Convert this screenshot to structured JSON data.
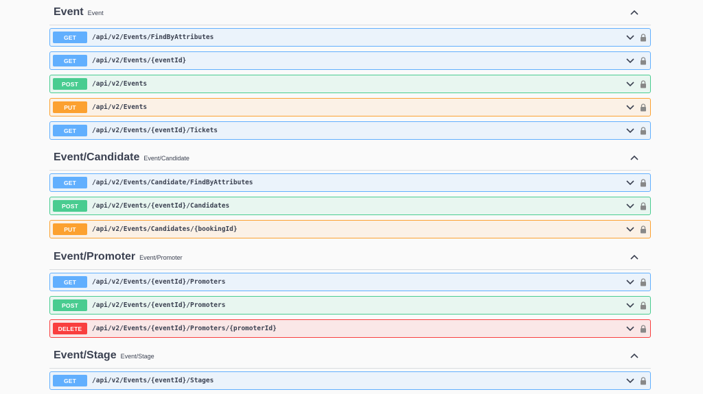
{
  "sections": [
    {
      "title": "Event",
      "description": "Event",
      "operations": [
        {
          "method": "GET",
          "path": "/api/v2/Events/FindByAttributes"
        },
        {
          "method": "GET",
          "path": "/api/v2/Events/{eventId}"
        },
        {
          "method": "POST",
          "path": "/api/v2/Events"
        },
        {
          "method": "PUT",
          "path": "/api/v2/Events"
        },
        {
          "method": "GET",
          "path": "/api/v2/Events/{eventId}/Tickets"
        }
      ]
    },
    {
      "title": "Event/Candidate",
      "description": "Event/Candidate",
      "operations": [
        {
          "method": "GET",
          "path": "/api/v2/Events/Candidate/FindByAttributes"
        },
        {
          "method": "POST",
          "path": "/api/v2/Events/{eventId}/Candidates"
        },
        {
          "method": "PUT",
          "path": "/api/v2/Events/Candidates/{bookingId}"
        }
      ]
    },
    {
      "title": "Event/Promoter",
      "description": "Event/Promoter",
      "operations": [
        {
          "method": "GET",
          "path": "/api/v2/Events/{eventId}/Promoters"
        },
        {
          "method": "POST",
          "path": "/api/v2/Events/{eventId}/Promoters"
        },
        {
          "method": "DELETE",
          "path": "/api/v2/Events/{eventId}/Promoters/{promoterId}"
        }
      ]
    },
    {
      "title": "Event/Stage",
      "description": "Event/Stage",
      "operations": [
        {
          "method": "GET",
          "path": "/api/v2/Events/{eventId}/Stages"
        }
      ]
    }
  ],
  "icons": {
    "section_toggle": "chevron-up-icon",
    "op_toggle": "chevron-down-icon",
    "auth": "lock-icon"
  },
  "colors": {
    "get": "#61affe",
    "post": "#49cc90",
    "put": "#fca130",
    "delete": "#f93e3e"
  }
}
